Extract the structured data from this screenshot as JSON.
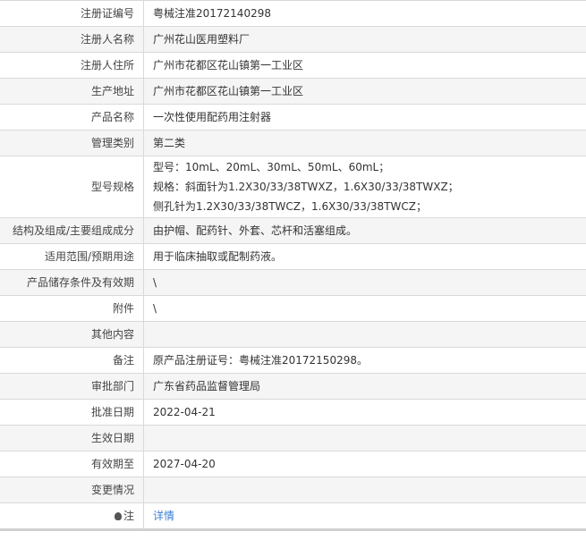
{
  "rows": [
    {
      "label": "注册证编号",
      "value": "粤械注准20172140298"
    },
    {
      "label": "注册人名称",
      "value": "广州花山医用塑料厂"
    },
    {
      "label": "注册人住所",
      "value": "广州市花都区花山镇第一工业区"
    },
    {
      "label": "生产地址",
      "value": "广州市花都区花山镇第一工业区"
    },
    {
      "label": "产品名称",
      "value": "一次性使用配药用注射器"
    },
    {
      "label": "管理类别",
      "value": "第二类"
    },
    {
      "label": "型号规格",
      "lines": [
        "型号：10mL、20mL、30mL、50mL、60mL；",
        "规格：斜面针为1.2X30/33/38TWXZ，1.6X30/33/38TWXZ；",
        "侧孔针为1.2X30/33/38TWCZ，1.6X30/33/38TWCZ；"
      ]
    },
    {
      "label": "结构及组成/主要组成成分",
      "value": "由护帽、配药针、外套、芯杆和活塞组成。"
    },
    {
      "label": "适用范围/预期用途",
      "value": "用于临床抽取或配制药液。"
    },
    {
      "label": "产品储存条件及有效期",
      "value": "\\"
    },
    {
      "label": "附件",
      "value": "\\"
    },
    {
      "label": "其他内容",
      "value": ""
    },
    {
      "label": "备注",
      "value": "原产品注册证号：粤械注准20172150298。"
    },
    {
      "label": "审批部门",
      "value": "广东省药品监督管理局"
    },
    {
      "label": "批准日期",
      "value": "2022-04-21"
    },
    {
      "label": "生效日期",
      "value": ""
    },
    {
      "label": "有效期至",
      "value": "2027-04-20"
    },
    {
      "label": "变更情况",
      "value": ""
    },
    {
      "label": "注",
      "value": "详情",
      "icon": "lightbulb-icon"
    }
  ]
}
